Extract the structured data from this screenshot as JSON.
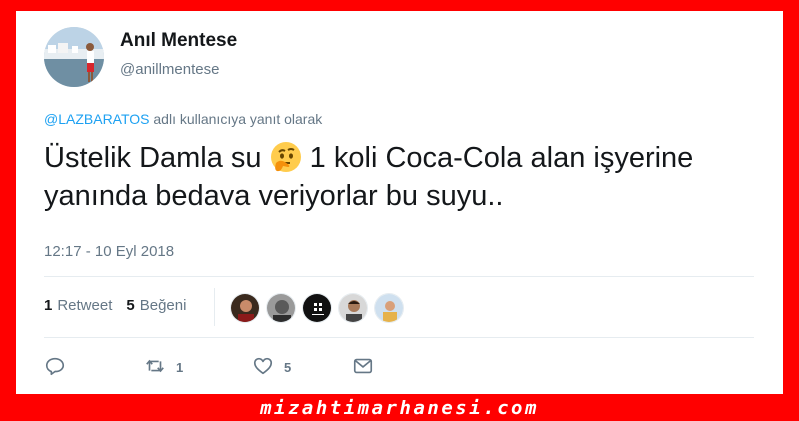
{
  "user": {
    "name": "Anıl Mentese",
    "handle": "@anillmentese"
  },
  "reply": {
    "mention": "@LAZBARATOS",
    "text": " adlı kullanıcıya yanıt olarak"
  },
  "tweet": {
    "before_emoji": "Üstelik Damla su ",
    "emoji": "thinking-face-emoji",
    "after_emoji": " 1 koli Coca-Cola alan işyerine yanında bedava veriyorlar bu suyu.."
  },
  "timestamp": "12:17 - 10 Eyl 2018",
  "stats": {
    "retweet_count": "1",
    "retweet_label": "Retweet",
    "like_count": "5",
    "like_label": "Beğeni"
  },
  "likers": [
    "liker-avatar-1",
    "liker-avatar-2",
    "liker-avatar-3",
    "liker-avatar-4",
    "liker-avatar-5"
  ],
  "actions": {
    "reply_icon": "reply-icon",
    "retweet_icon": "retweet-icon",
    "retweet_count": "1",
    "like_icon": "heart-icon",
    "like_count": "5",
    "dm_icon": "envelope-icon"
  },
  "footer": {
    "watermark": "mizahtimarhanesi.com"
  },
  "colors": {
    "frame": "#ff0000",
    "link": "#1da1f2",
    "muted": "#657786",
    "text": "#14171a"
  }
}
